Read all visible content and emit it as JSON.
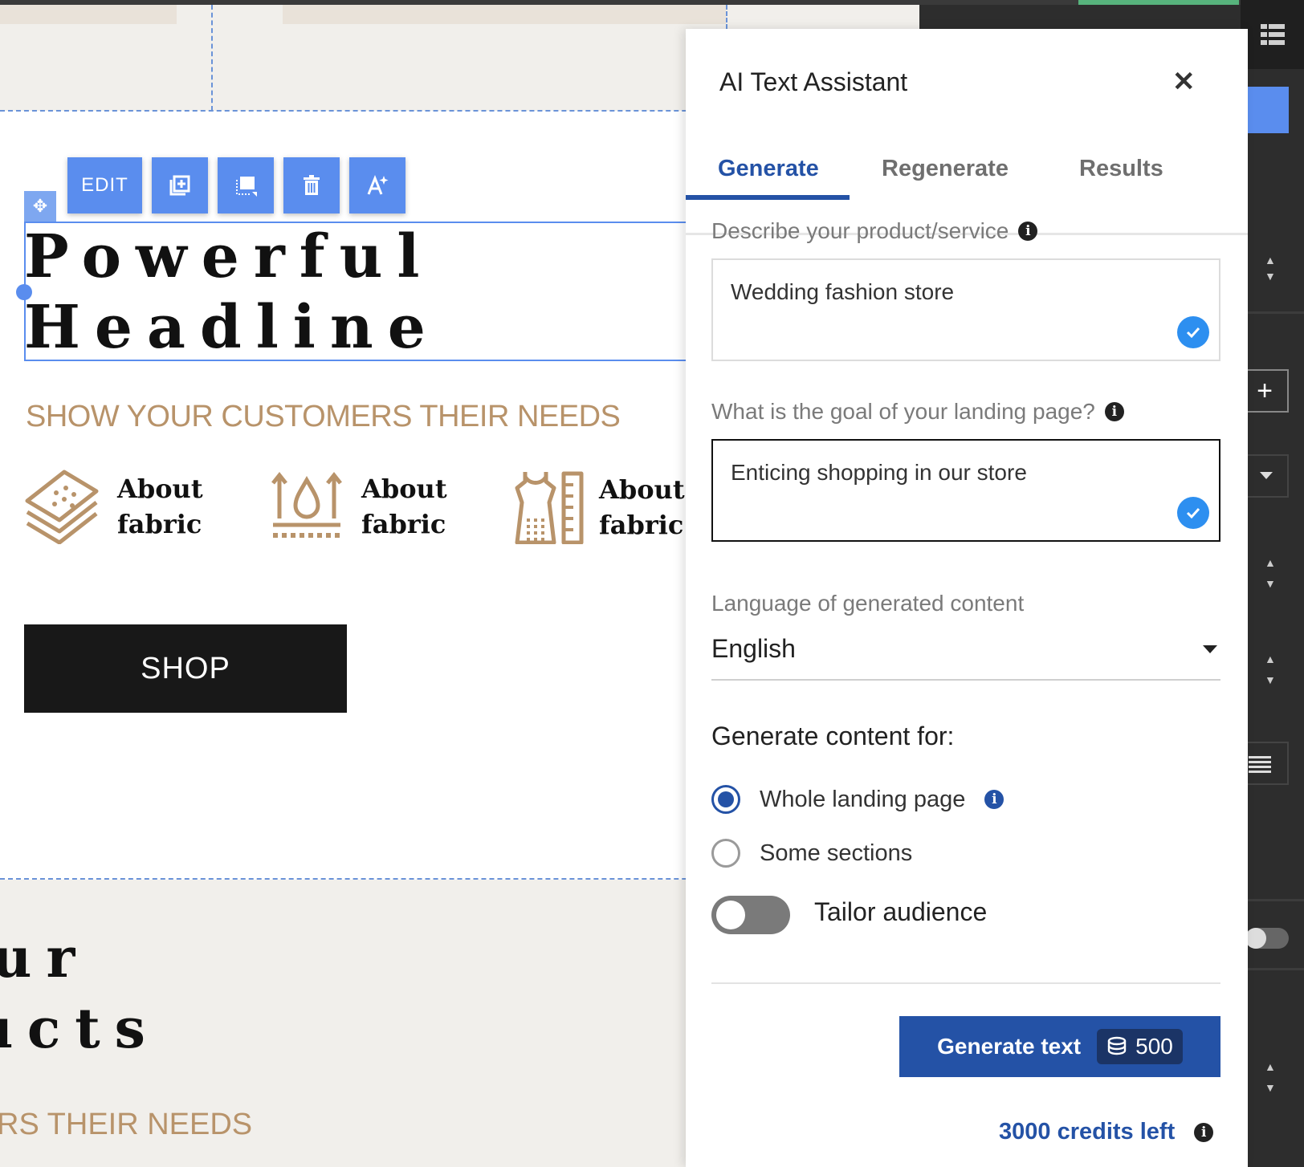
{
  "canvas": {
    "toolbar": {
      "edit_label": "EDIT"
    },
    "headline": "Powerful\nHeadline",
    "subheading": "SHOW YOUR CUSTOMERS THEIR NEEDS",
    "features": [
      {
        "label": "About\nfabric",
        "icon": "fabric-layers-icon"
      },
      {
        "label": "About\nfabric",
        "icon": "breathable-fabric-icon"
      },
      {
        "label": "About\nfabric",
        "icon": "dress-measure-icon"
      }
    ],
    "shop_label": "SHOP",
    "next_section": {
      "headline_partial": "ur\nıcts",
      "subheading_partial": "RS THEIR NEEDS"
    }
  },
  "panel": {
    "title": "AI Text Assistant",
    "tabs": [
      "Generate",
      "Regenerate",
      "Results"
    ],
    "active_tab": "Generate",
    "product_label": "Describe your product/service",
    "product_value": "Wedding fashion store",
    "goal_label": "What is the goal of your landing page?",
    "goal_value": "Enticing shopping in our store",
    "language_label": "Language of generated content",
    "language_value": "English",
    "generate_for_label": "Generate content for:",
    "options": [
      {
        "label": "Whole landing page",
        "selected": true
      },
      {
        "label": "Some sections",
        "selected": false
      }
    ],
    "tailor_label": "Tailor audience",
    "tailor_enabled": false,
    "generate_button": "Generate text",
    "cost": "500",
    "credits_left": "3000 credits left"
  },
  "colors": {
    "accent": "#2452a6",
    "editor_blue": "#5a8dee",
    "gold": "#b8936a",
    "check_blue": "#2d8ff0"
  }
}
